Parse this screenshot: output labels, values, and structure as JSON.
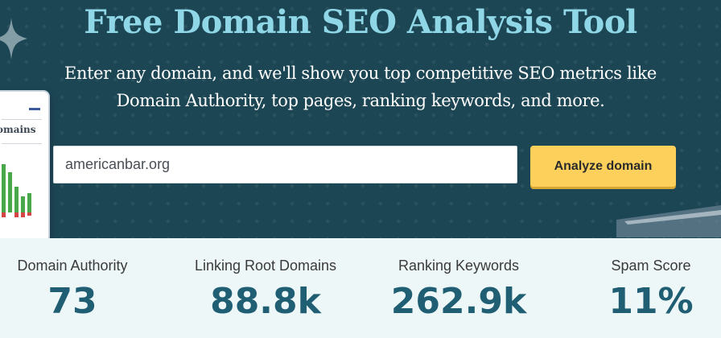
{
  "hero": {
    "title": "Free Domain SEO Analysis Tool",
    "subtitle_line1": "Enter any domain, and we'll show you top competitive SEO metrics like",
    "subtitle_line2": "Domain Authority, top pages, ranking keywords, and more."
  },
  "search": {
    "value": "americanbar.org",
    "button_label": "Analyze domain"
  },
  "decoration": {
    "card_label": "omains"
  },
  "metrics": [
    {
      "label": "Domain Authority",
      "value": "73"
    },
    {
      "label": "Linking Root Domains",
      "value": "88.8k"
    },
    {
      "label": "Ranking Keywords",
      "value": "262.9k"
    },
    {
      "label": "Spam Score",
      "value": "11%"
    }
  ],
  "colors": {
    "hero_bg": "#1d4654",
    "title": "#8fd6e6",
    "button": "#fdd05b",
    "metric_value": "#1f5e73"
  }
}
